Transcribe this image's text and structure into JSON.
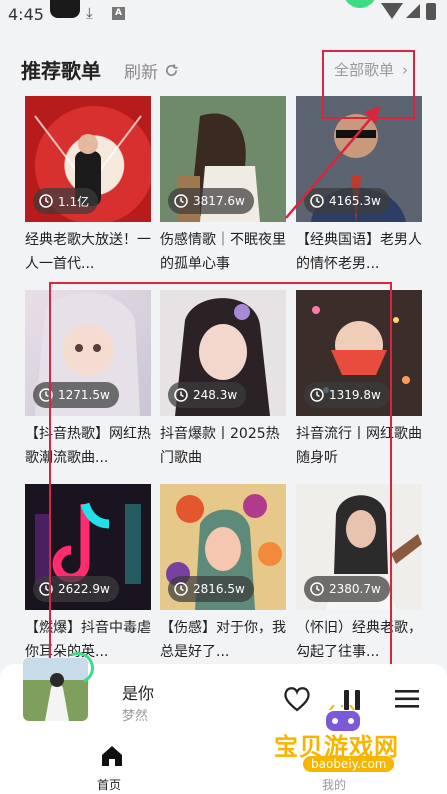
{
  "status_bar": {
    "time": "4:45"
  },
  "header": {
    "title": "推荐歌单",
    "refresh_label": "刷新",
    "all_lists_label": "全部歌单"
  },
  "playlists": [
    {
      "plays": "1.1亿",
      "title": "经典老歌大放送！一人一首代..."
    },
    {
      "plays": "3817.6w",
      "title": "伤感情歌｜不眠夜里的孤单心事"
    },
    {
      "plays": "4165.3w",
      "title": "【经典国语】老男人的情怀老男..."
    },
    {
      "plays": "1271.5w",
      "title": "【抖音热歌】网红热歌潮流歌曲..."
    },
    {
      "plays": "248.3w",
      "title": "抖音爆款丨2025热门歌曲"
    },
    {
      "plays": "1319.8w",
      "title": "抖音流行丨网红歌曲随身听"
    },
    {
      "plays": "2622.9w",
      "title": "【燃爆】抖音中毒虐你耳朵的英..."
    },
    {
      "plays": "2816.5w",
      "title": "【伤感】对于你，我总是好了..."
    },
    {
      "plays": "2380.7w",
      "title": "（怀旧）经典老歌，勾起了往事..."
    }
  ],
  "player": {
    "song": "是你",
    "artist": "梦然"
  },
  "nav": {
    "home_label": "首页",
    "mine_label": "我的"
  },
  "watermark": {
    "text": "宝贝游戏网",
    "url": "baobeiy.com"
  },
  "colors": {
    "accent": "#3ddc84",
    "annotation": "#d7263d",
    "watermark": "#f7b500"
  }
}
